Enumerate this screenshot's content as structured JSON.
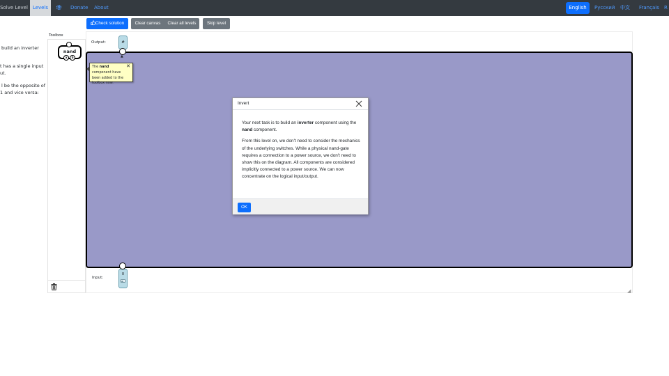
{
  "nav": {
    "solve_level": "Solve Level",
    "levels": "Levels",
    "gear_icon": "gear-icon",
    "donate": "Donate",
    "about": "About",
    "languages": [
      "English",
      "Русский",
      "中文",
      "Français",
      "R"
    ],
    "active_language": "English"
  },
  "instructions": {
    "line1": "build an inverter",
    "line2": "t has a single input",
    "line3": "ut.",
    "line4": "l be the opposite of",
    "line5": "1 and vice versa:"
  },
  "toolbar": {
    "check_icon": "thumbs-up-icon",
    "check_solution": "Check solution",
    "clear_canvas": "Clear canvas",
    "clear_all_levels": "Clear all levels",
    "skip_level": "Skip level"
  },
  "toolbox": {
    "label": "Toolbox",
    "component": {
      "name": "nand",
      "inputs": [
        "a",
        "b"
      ]
    },
    "trash_icon": "trash-icon"
  },
  "canvas": {
    "output_label": "Output:",
    "output_name": "#",
    "input_label": "Input:",
    "input_name": "0",
    "background_color": "#9999c8"
  },
  "tooltip": {
    "before": "The ",
    "component": "nand",
    "after": " component have been added to the toolbox now."
  },
  "modal": {
    "title": "Invert",
    "p1_before": "Your next task is to build an ",
    "p1_bold1": "inverter",
    "p1_middle": " component using the ",
    "p1_bold2": "nand",
    "p1_after": " component.",
    "p2": "From this level on, we don't need to consider the mechanics of the underlying switches. While a physical nand-gate requires a connection to a power source, we don't need to show this on the diagram. All components are considered implicitly connected to a power source. We can now concentrate on the logical input/output.",
    "ok_label": "OK"
  },
  "colors": {
    "navbar": "#343a40",
    "primary": "#0d6efd",
    "secondary": "#6c757d",
    "tooltip_bg": "#ffffc4"
  }
}
